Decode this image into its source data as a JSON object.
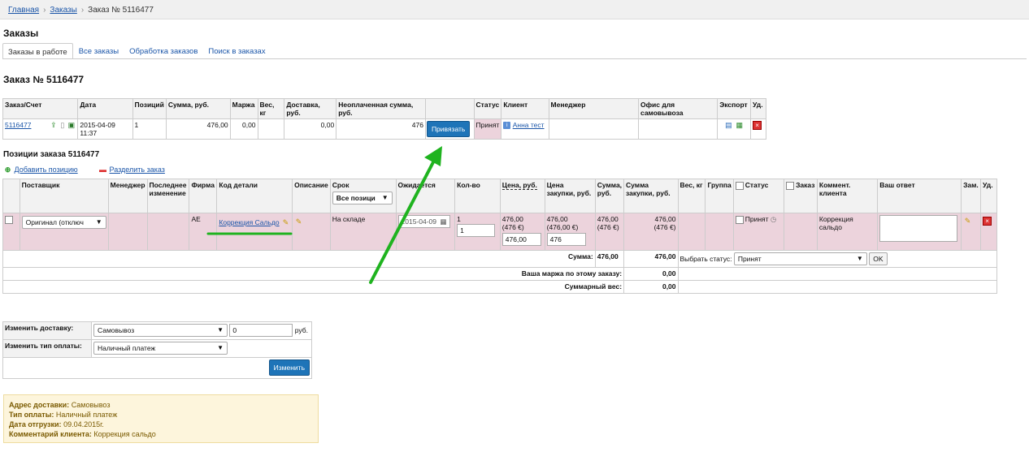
{
  "breadcrumb": {
    "home": "Главная",
    "orders": "Заказы",
    "current": "Заказ № 5116477"
  },
  "page_title": "Заказы",
  "tabs": [
    "Заказы в работе",
    "Все заказы",
    "Обработка заказов",
    "Поиск в заказах"
  ],
  "order_title": "Заказ № 5116477",
  "order_table": {
    "headers": [
      "Заказ/Счет",
      "Дата",
      "Позиций",
      "Сумма, руб.",
      "Маржа",
      "Вес, кг",
      "Доставка, руб.",
      "Неоплаченная сумма, руб.",
      "",
      "Статус",
      "Клиент",
      "Менеджер",
      "Офис для самовывоза",
      "Экспорт",
      "Уд."
    ],
    "row": {
      "order": "5116477",
      "date": "2015-04-09 11:37",
      "positions": "1",
      "sum": "476,00",
      "margin": "0,00",
      "weight": "",
      "delivery": "0,00",
      "unpaid": "476",
      "bind_btn": "Привязать",
      "status": "Принят",
      "client": "Анна тест",
      "manager": "",
      "office": ""
    }
  },
  "positions_title": "Позиции заказа 5116477",
  "actions": {
    "add": "Добавить позицию",
    "split": "Разделить заказ"
  },
  "pos_table": {
    "headers": {
      "supplier": "Поставщик",
      "manager": "Менеджер",
      "last_change": "Последнее изменение",
      "firm": "Фирма",
      "code": "Код детали",
      "desc": "Описание",
      "term": "Срок",
      "term_filter": "Все позици",
      "expected": "Ожидается",
      "qty": "Кол-во",
      "price": "Цена, руб.",
      "purchase_price": "Цена закупки, руб.",
      "sum": "Сумма, руб.",
      "purchase_sum": "Сумма закупки, руб.",
      "weight": "Вес, кг",
      "group": "Группа",
      "status": "Статус",
      "order": "Заказ",
      "comment": "Коммент. клиента",
      "answer": "Ваш ответ",
      "rep": "Зам.",
      "del": "Уд."
    },
    "row": {
      "supplier": "Оригинал (отключ",
      "firm": "AE",
      "code": "Коррекция Сальдо",
      "term": "На складе",
      "expected": "2015-04-09",
      "qty": "1",
      "qty_input": "1",
      "price": "476,00",
      "price_eur": "(476 €)",
      "price_input": "476,00",
      "pprice": "476,00",
      "pprice_eur": "(476,00 €)",
      "pprice_input": "476",
      "sum": "476,00",
      "sum_eur": "(476 €)",
      "psum": "476,00",
      "psum_eur": "(476 €)",
      "status": "Принят",
      "comment": "Коррекция сальдо"
    },
    "total_label": "Сумма:",
    "total_sum": "476,00",
    "total_psum": "476,00",
    "choose_status": "Выбрать статус:",
    "status_select": "Принят",
    "ok": "OK",
    "margin_label": "Ваша маржа по этому заказу:",
    "margin_value": "0,00",
    "weight_label": "Суммарный вес:",
    "weight_value": "0,00"
  },
  "change": {
    "delivery_label": "Изменить доставку:",
    "delivery_value": "Самовывоз",
    "delivery_amount": "0",
    "currency": "руб.",
    "payment_label": "Изменить тип оплаты:",
    "payment_value": "Наличный платеж",
    "button": "Изменить"
  },
  "info": [
    {
      "k": "Адрес доставки:",
      "v": "Самовывоз"
    },
    {
      "k": "Тип оплаты:",
      "v": "Наличный платеж"
    },
    {
      "k": "Дата отгрузки:",
      "v": "09.04.2015г."
    },
    {
      "k": "Комментарий клиента:",
      "v": "Коррекция сальдо"
    }
  ]
}
